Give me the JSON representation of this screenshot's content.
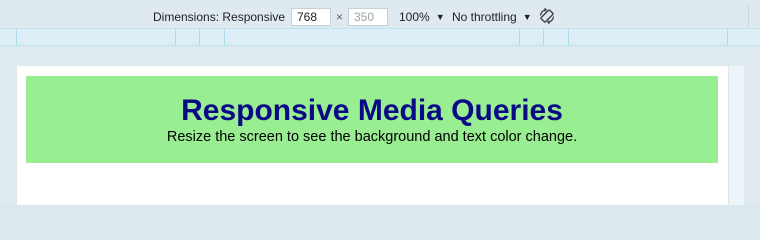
{
  "toolbar": {
    "dimensions_label": "Dimensions: Responsive",
    "width_value": "768",
    "height_value": "350",
    "times_symbol": "×",
    "zoom_label": "100%",
    "throttling_label": "No throttling",
    "caret": "▼"
  },
  "page": {
    "heading": "Responsive Media Queries",
    "subtext": "Resize the screen to see the background and text color change."
  },
  "colors": {
    "hero_background": "#98ee90",
    "heading_color": "#0b0a86",
    "toolbar_background": "#dfeaf0",
    "media_query_bar": "#dceff6"
  },
  "icons": {
    "rotate": "rotate-icon"
  }
}
